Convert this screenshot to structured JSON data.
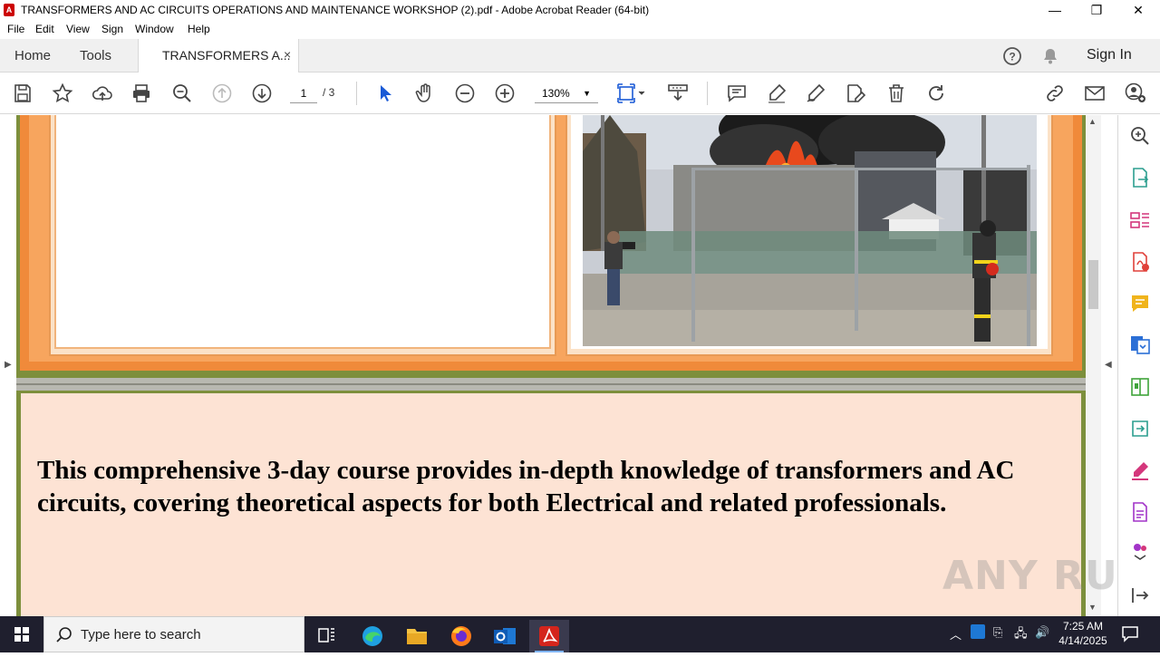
{
  "window": {
    "title": "TRANSFORMERS AND AC CIRCUITS OPERATIONS AND MAINTENANCE WORKSHOP (2).pdf - Adobe Acrobat Reader (64-bit)",
    "minimize": "—",
    "maximize": "❐",
    "close": "✕"
  },
  "menu": [
    "File",
    "Edit",
    "View",
    "Sign",
    "Window",
    "Help"
  ],
  "tabs": {
    "home": "Home",
    "tools": "Tools",
    "document": "TRANSFORMERS A...",
    "close": "×",
    "sign_in": "Sign In"
  },
  "toolbar": {
    "page_current": "1",
    "page_total": "/ 3",
    "zoom": "130%",
    "icons": [
      "save-icon",
      "star-icon",
      "upload-icon",
      "print-icon",
      "zoom-search-icon",
      "page-up-icon",
      "page-down-icon",
      "select-arrow-icon",
      "hand-icon",
      "zoom-out-icon",
      "zoom-in-icon",
      "fit-page-icon",
      "scroll-mode-icon",
      "comment-icon",
      "highlight-icon",
      "sign-icon",
      "edit-icon",
      "delete-icon",
      "rotate-icon",
      "link-icon",
      "mail-icon",
      "share-user-icon"
    ]
  },
  "document": {
    "body_text": "This comprehensive 3-day course provides in-depth knowledge of transformers and AC circuits, covering theoretical aspects for both Electrical and related professionals.",
    "watermark": "ANY RUN",
    "photo_description_icon": "substation-fire-photo"
  },
  "right_panel_icons": [
    "search-zoom-icon",
    "export-pdf-icon",
    "organize-pages-icon",
    "create-pdf-icon",
    "comment-icon",
    "combine-files-icon",
    "compress-icon",
    "send-for-review-icon",
    "fill-sign-icon",
    "edit-pdf-icon",
    "more-tools-icon",
    "collapse-panel-icon"
  ],
  "colors": {
    "frame_orange": "#f08a3a",
    "frame_green": "#7d8f3c",
    "content_bg": "#fde3d4",
    "acrobat_red": "#c00000",
    "taskbar": "#1f1f2e"
  },
  "taskbar": {
    "search_placeholder": "Type here to search",
    "time": "7:25 AM",
    "date": "4/14/2025"
  }
}
